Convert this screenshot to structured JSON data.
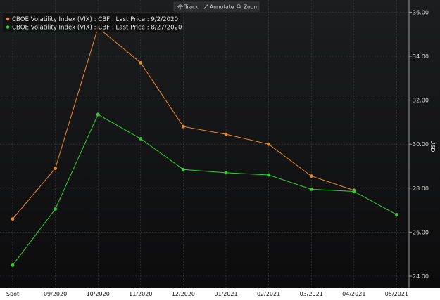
{
  "toolbar": {
    "track_label": "Track",
    "annotate_label": "Annotate",
    "zoom_label": "Zoom",
    "track_icon": "crosshair-icon",
    "annotate_icon": "pencil-icon",
    "zoom_icon": "magnifier-icon"
  },
  "chart_data": {
    "type": "line",
    "title": "",
    "xlabel": "",
    "ylabel": "USD",
    "categories": [
      "Spot",
      "09/2020",
      "10/2020",
      "11/2020",
      "12/2020",
      "01/2021",
      "02/2021",
      "03/2021",
      "04/2021",
      "05/2021"
    ],
    "yticks": [
      "24.00",
      "26.00",
      "28.00",
      "30.00",
      "32.00",
      "34.00",
      "36.00"
    ],
    "ylim": [
      23.5,
      36.5
    ],
    "y_axis_side": "right",
    "grid": true,
    "legend_position": "top-left",
    "background_color": "#151515",
    "series": [
      {
        "name": "CBOE Volatility Index (VIX) : CBF : Last Price : 9/2/2020",
        "color": "#e8892a",
        "values": [
          26.6,
          28.9,
          35.3,
          33.7,
          30.8,
          30.45,
          30.0,
          28.55,
          27.9,
          null
        ]
      },
      {
        "name": "CBOE Volatility Index (VIX) : CBF : Last Price : 8/27/2020",
        "color": "#2fd12f",
        "values": [
          24.5,
          27.05,
          31.35,
          30.25,
          28.85,
          28.7,
          28.6,
          27.95,
          27.85,
          26.8
        ]
      }
    ]
  }
}
